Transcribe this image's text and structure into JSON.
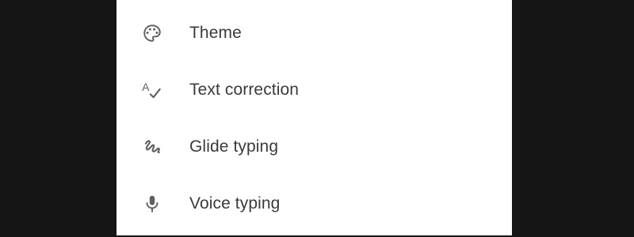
{
  "settings_menu": {
    "items": [
      {
        "label": "Theme",
        "icon": "palette-icon"
      },
      {
        "label": "Text correction",
        "icon": "spellcheck-icon"
      },
      {
        "label": "Glide typing",
        "icon": "gesture-icon"
      },
      {
        "label": "Voice typing",
        "icon": "microphone-icon"
      }
    ]
  },
  "colors": {
    "background": "#151515",
    "panel": "#ffffff",
    "icon": "#616161",
    "text": "#3a3a3a"
  }
}
